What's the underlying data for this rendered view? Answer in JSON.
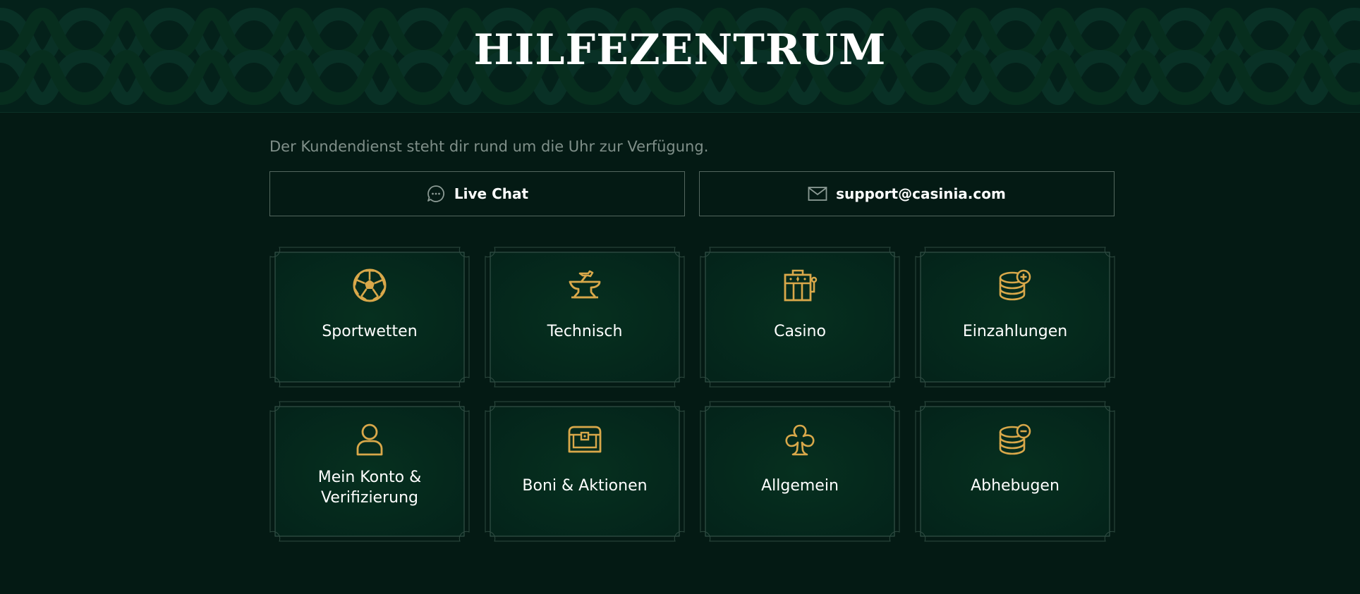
{
  "header": {
    "title": "HILFEZENTRUM"
  },
  "intro": {
    "text": "Der Kundendienst steht dir rund um die Uhr zur Verfügung."
  },
  "contact": {
    "live_chat_label": "Live Chat",
    "email_label": "support@casinia.com"
  },
  "categories": [
    {
      "label": "Sportwetten",
      "icon": "soccer-ball-icon"
    },
    {
      "label": "Technisch",
      "icon": "anvil-icon"
    },
    {
      "label": "Casino",
      "icon": "slot-machine-icon"
    },
    {
      "label": "Einzahlungen",
      "icon": "coins-plus-icon"
    },
    {
      "label_line1": "Mein Konto &",
      "label_line2": "Verifizierung",
      "icon": "user-icon"
    },
    {
      "label": "Boni & Aktionen",
      "icon": "treasure-chest-icon"
    },
    {
      "label": "Allgemein",
      "icon": "club-suit-icon"
    },
    {
      "label": "Abhebugen",
      "icon": "coins-minus-icon"
    }
  ],
  "colors": {
    "background": "#041a14",
    "card_background": "#05271d",
    "accent_gold": "#d9a84a",
    "border": "#54675f",
    "muted_text": "#7f8f89"
  }
}
